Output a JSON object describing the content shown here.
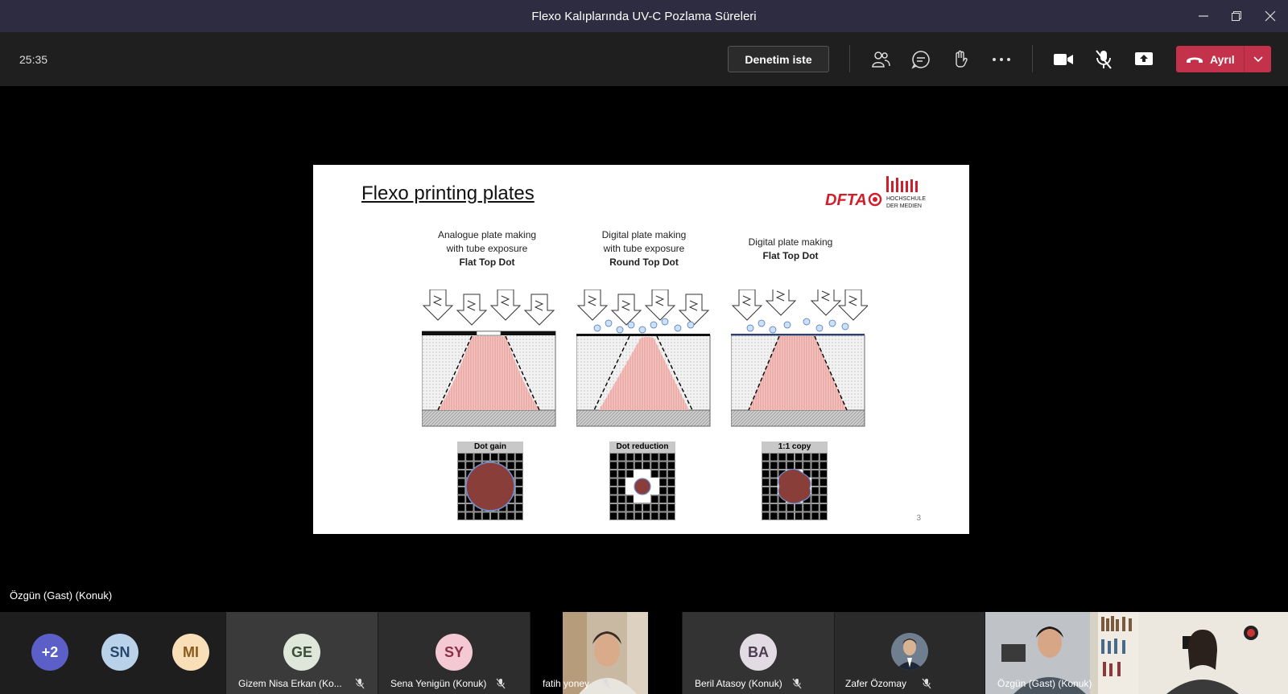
{
  "window": {
    "title": "Flexo Kalıplarında UV-C Pozlama Süreleri"
  },
  "toolbar": {
    "timer": "25:35",
    "admit_label": "Denetim iste",
    "leave_label": "Ayrıl"
  },
  "slide": {
    "title": "Flexo printing plates",
    "logo_text": "DFTA",
    "logo_sub1": "HOCHSCHULE",
    "logo_sub2": "DER MEDIEN",
    "columns": [
      {
        "line1": "Analogue plate making",
        "line2": "with tube exposure",
        "bold": "Flat Top Dot",
        "dot_label": "Dot gain"
      },
      {
        "line1": "Digital plate making",
        "line2": "with tube exposure",
        "bold": "Round Top Dot",
        "dot_label": "Dot reduction"
      },
      {
        "line1": "Digital plate making",
        "line2": "",
        "bold": "Flat Top Dot",
        "dot_label": "1:1 copy"
      }
    ],
    "page_number": "3"
  },
  "speaker": {
    "name": "Özgün (Gast) (Konuk)"
  },
  "participants": [
    {
      "initials": "+2",
      "name": "",
      "color": "#5b5fc7",
      "text_color": "#ffffff"
    },
    {
      "initials": "SN",
      "name": "",
      "color": "#b9d2ea",
      "text_color": "#27466e"
    },
    {
      "initials": "MI",
      "name": "",
      "color": "#f8dfb8",
      "text_color": "#8a5a1c"
    },
    {
      "initials": "GE",
      "name": "Gizem Nisa Erkan (Ko...",
      "color": "#dfe7da",
      "text_color": "#3c4f34"
    },
    {
      "initials": "SY",
      "name": "Sena Yenigün (Konuk)",
      "color": "#f5c9d3",
      "text_color": "#8a2f45"
    },
    {
      "initials": "",
      "name": "fatih yoney",
      "color": "",
      "text_color": ""
    },
    {
      "initials": "BA",
      "name": "Beril Atasoy (Konuk)",
      "color": "#e2dbe3",
      "text_color": "#4e3d52"
    },
    {
      "initials": "",
      "name": "Zafer Özomay",
      "color": "",
      "text_color": ""
    },
    {
      "initials": "",
      "name": "Özgün (Gast) (Konuk)",
      "color": "",
      "text_color": ""
    }
  ]
}
